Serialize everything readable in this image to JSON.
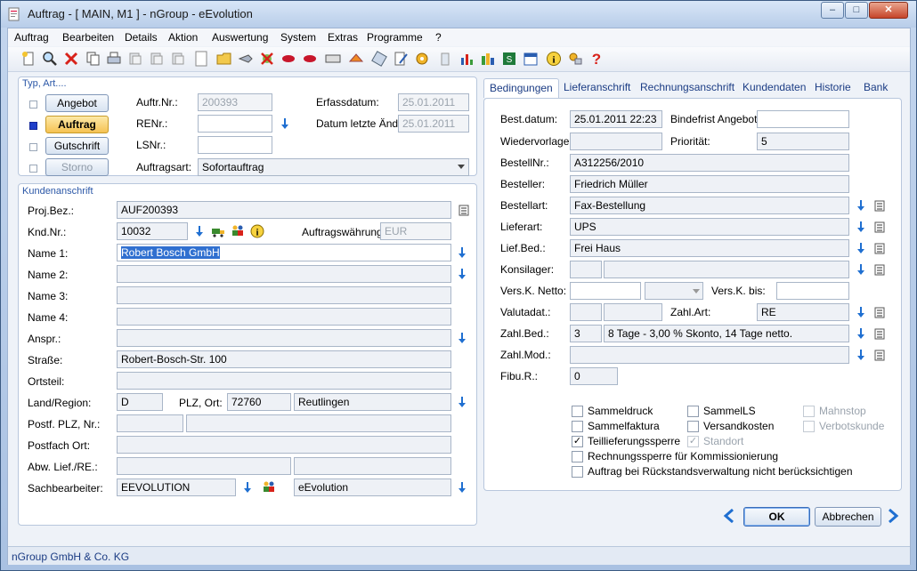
{
  "window": {
    "title": "Auftrag - [ MAIN, M1 ]  -  nGroup - eEvolution"
  },
  "menu": [
    "Auftrag",
    "Bearbeiten",
    "Details",
    "Aktion",
    "Auswertung",
    "System",
    "Extras",
    "Programme",
    "?"
  ],
  "typ": {
    "label": "Typ, Art....",
    "buttons": [
      "Angebot",
      "Auftrag",
      "Gutschrift",
      "Storno"
    ],
    "auftr_nr_label": "Auftr.Nr.:",
    "auftr_nr": "200393",
    "erfassdatum_label": "Erfassdatum:",
    "erfassdatum": "25.01.2011",
    "renr_label": "RENr.:",
    "renr": "",
    "datum_aend_label": "Datum letzte Änd.:",
    "datum_aend": "25.01.2011",
    "lsnr_label": "LSNr.:",
    "lsnr": "",
    "auftragsart_label": "Auftragsart:",
    "auftragsart": "Sofortauftrag"
  },
  "kunde": {
    "label": "Kundenanschrift",
    "proj_label": "Proj.Bez.:",
    "proj": "AUF200393",
    "kndnr_label": "Knd.Nr.:",
    "kndnr": "10032",
    "waehrung_label": "Auftragswährung:",
    "waehrung": "EUR",
    "name1_label": "Name 1:",
    "name1": "Robert Bosch GmbH",
    "name2_label": "Name 2:",
    "name3_label": "Name 3:",
    "name4_label": "Name 4:",
    "anspr_label": "Anspr.:",
    "strasse_label": "Straße:",
    "strasse": "Robert-Bosch-Str. 100",
    "ortsteil_label": "Ortsteil:",
    "land_label": "Land/Region:",
    "land": "D",
    "plz_label": "PLZ, Ort:",
    "plz": "72760",
    "ort": "Reutlingen",
    "postf_label": "Postf. PLZ, Nr.:",
    "postfort_label": "Postfach Ort:",
    "abw_label": "Abw. Lief./RE.:",
    "sb_label": "Sachbearbeiter:",
    "sb": "EEVOLUTION",
    "sb2": "eEvolution"
  },
  "tabs": [
    "Bedingungen",
    "Lieferanschrift",
    "Rechnungsanschrift",
    "Kundendaten",
    "Historie",
    "Bank"
  ],
  "bed": {
    "bestdatum_label": "Best.datum:",
    "bestdatum": "25.01.2011 22:23",
    "bindefrist_label": "Bindefrist Angebot:",
    "bindefrist": "",
    "wiedervorlage_label": "Wiedervorlage:",
    "prioritaet_label": "Priorität:",
    "prioritaet": "5",
    "bestellnr_label": "BestellNr.:",
    "bestellnr": "A312256/2010",
    "besteller_label": "Besteller:",
    "besteller": "Friedrich Müller",
    "bestellart_label": "Bestellart:",
    "bestellart": "Fax-Bestellung",
    "lieferart_label": "Lieferart:",
    "lieferart": "UPS",
    "liefbed_label": "Lief.Bed.:",
    "liefbed": "Frei Haus",
    "konsilager_label": "Konsilager:",
    "verskn_label": "Vers.K. Netto:",
    "verskbis_label": "Vers.K. bis:",
    "valuta_label": "Valutadat.:",
    "zahlart_label": "Zahl.Art:",
    "zahlart": "RE",
    "zahlbed_label": "Zahl.Bed.:",
    "zahlbed_code": "3",
    "zahlbed": "8 Tage - 3,00 % Skonto, 14 Tage netto.",
    "zahlmod_label": "Zahl.Mod.:",
    "fibu_label": "Fibu.R.:",
    "fibu": "0"
  },
  "checks": {
    "sammeldruck": "Sammeldruck",
    "sammells": "SammelLS",
    "mahnstop": "Mahnstop",
    "sammelfaktura": "Sammelfaktura",
    "versandkosten": "Versandkosten",
    "verbotskunde": "Verbotskunde",
    "teillieferungssperre": "Teillieferungssperre",
    "standort": "Standort",
    "rechnungssperre": "Rechnungssperre für Kommissionierung",
    "rueckstand": "Auftrag bei Rückstandsverwaltung nicht berücksichtigen"
  },
  "footer": {
    "ok": "OK",
    "abbrechen": "Abbrechen",
    "status": "nGroup GmbH & Co. KG"
  },
  "colors": {
    "accent_blue": "#1f6fd1",
    "active_button": "#f5c253"
  }
}
